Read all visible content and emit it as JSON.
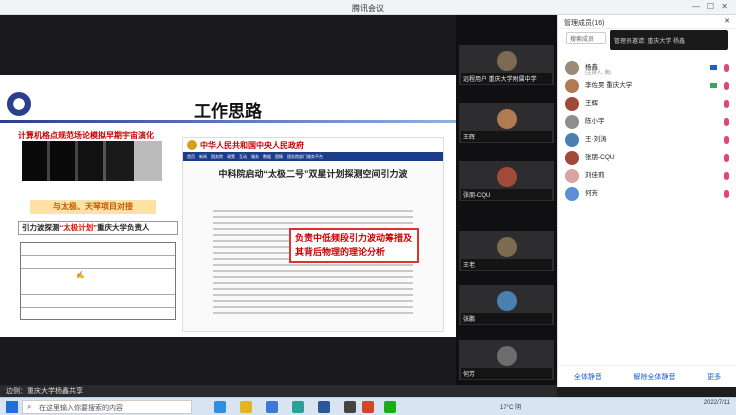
{
  "window": {
    "title": "腾讯会议"
  },
  "slide": {
    "title": "工作思路",
    "simulation_line": "计算机格点规范场论模拟早期宇宙演化",
    "collab_label": "与太极、天琴项目对接",
    "gw_label_prefix": "引力波探测",
    "gw_label_highlight": "“太极计划”",
    "gw_label_suffix": "重庆大学负责人",
    "website": {
      "site_name": "中华人民共和国中央人民政府",
      "nav": [
        "首页",
        "新闻",
        "国务院",
        "政策",
        "互动",
        "服务",
        "数据",
        "国情",
        "国务院部门服务平台"
      ],
      "article_title": "中科院启动“太极二号”双星计划探测空间引力波",
      "callout": "负责中低频段引力波动筹措及其背后物理的理论分析"
    }
  },
  "share": {
    "presenter": "边侧：重庆大学杨鑫共享"
  },
  "videos": [
    {
      "name": "远程用户 重庆大学附属中学"
    },
    {
      "name": "王辉"
    },
    {
      "name": "张朋-CQU"
    },
    {
      "name": "王老"
    },
    {
      "name": "张鹏"
    },
    {
      "name": "何芳"
    }
  ],
  "panel": {
    "header": "管理成员(16)",
    "close": "✕",
    "search_placeholder": "搜索成员",
    "highlight_bar": "管理员邀请: 重庆大学 杨鑫",
    "participants": [
      {
        "name": "杨鑫",
        "sub": "(主持人, 我)"
      },
      {
        "name": "李佐昊 重庆大学",
        "sub": ""
      },
      {
        "name": "王辉",
        "sub": ""
      },
      {
        "name": "陈小宇",
        "sub": ""
      },
      {
        "name": "王·刘涛",
        "sub": ""
      },
      {
        "name": "张朋-CQU",
        "sub": ""
      },
      {
        "name": "刘佳莉",
        "sub": ""
      },
      {
        "name": "何芳",
        "sub": ""
      }
    ],
    "actions": [
      "全体静音",
      "解除全体静音",
      "更多"
    ]
  },
  "taskbar": {
    "search_placeholder": "在这里输入你要搜索的内容",
    "weather": "17°C 阴",
    "clock": "2022/7/11"
  },
  "colors": {
    "accent": "#1a5fd0",
    "mute_red": "#e4447a",
    "slide_red": "#cc0000"
  }
}
